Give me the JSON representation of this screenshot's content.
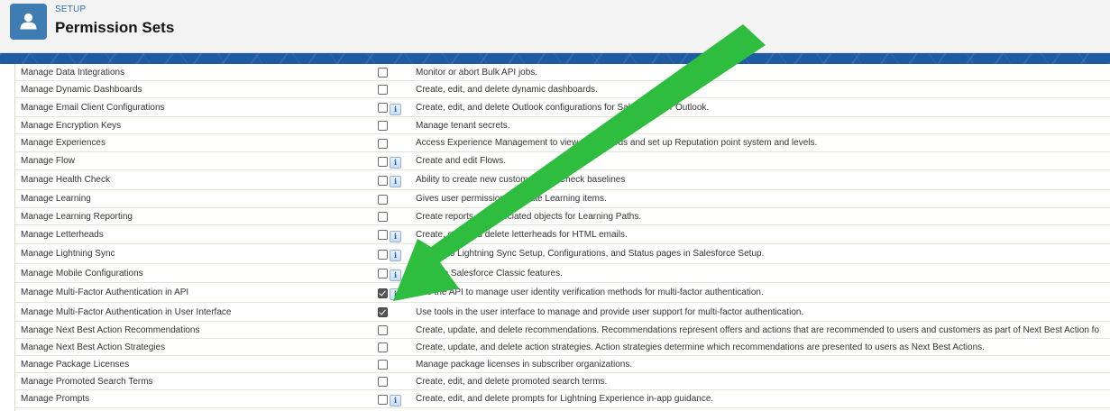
{
  "header": {
    "breadcrumb": "SETUP",
    "title": "Permission Sets",
    "icon": "user-icon",
    "icon_color": "#3e7cb1"
  },
  "annotation": {
    "arrow_color": "#2ebd3e"
  },
  "permissions": [
    {
      "name": "Manage Data Integrations",
      "description": "Monitor or abort Bulk API jobs.",
      "checked": false,
      "info": false
    },
    {
      "name": "Manage Dynamic Dashboards",
      "description": "Create, edit, and delete dynamic dashboards.",
      "checked": false,
      "info": false
    },
    {
      "name": "Manage Email Client Configurations",
      "description": "Create, edit, and delete Outlook configurations for Salesforce for Outlook.",
      "checked": false,
      "info": true
    },
    {
      "name": "Manage Encryption Keys",
      "description": "Manage tenant secrets.",
      "checked": false,
      "info": false
    },
    {
      "name": "Manage Experiences",
      "description": "Access Experience Management to view dashboards and set up Reputation point system and levels.",
      "checked": false,
      "info": false
    },
    {
      "name": "Manage Flow",
      "description": "Create and edit Flows.",
      "checked": false,
      "info": true
    },
    {
      "name": "Manage Health Check",
      "description": "Ability to create new custom Health Check baselines",
      "checked": false,
      "info": true
    },
    {
      "name": "Manage Learning",
      "description": "Gives user permission to create Learning items.",
      "checked": false,
      "info": false
    },
    {
      "name": "Manage Learning Reporting",
      "description": "Create reports on associated objects for Learning Paths.",
      "checked": false,
      "info": false
    },
    {
      "name": "Manage Letterheads",
      "description": "Create, edit, and delete letterheads for HTML emails.",
      "checked": false,
      "info": true
    },
    {
      "name": "Manage Lightning Sync",
      "description": "Access to Lightning Sync Setup, Configurations, and Status pages in Salesforce Setup.",
      "checked": false,
      "info": true
    },
    {
      "name": "Manage Mobile Configurations",
      "description": "Manage Salesforce Classic features.",
      "checked": false,
      "info": true
    },
    {
      "name": "Manage Multi-Factor Authentication in API",
      "description": "Use the API to manage user identity verification methods for multi-factor authentication.",
      "checked": true,
      "info": true
    },
    {
      "name": "Manage Multi-Factor Authentication in User Interface",
      "description": "Use tools in the user interface to manage and provide user support for multi-factor authentication.",
      "checked": true,
      "info": false
    },
    {
      "name": "Manage Next Best Action Recommendations",
      "description": "Create, update, and delete recommendations. Recommendations represent offers and actions that are recommended to users and customers as part of Next Best Action fo",
      "checked": false,
      "info": false
    },
    {
      "name": "Manage Next Best Action Strategies",
      "description": "Create, update, and delete action strategies. Action strategies determine which recommendations are presented to users as Next Best Actions.",
      "checked": false,
      "info": false
    },
    {
      "name": "Manage Package Licenses",
      "description": "Manage package licenses in subscriber organizations.",
      "checked": false,
      "info": false
    },
    {
      "name": "Manage Promoted Search Terms",
      "description": "Create, edit, and delete promoted search terms.",
      "checked": false,
      "info": false
    },
    {
      "name": "Manage Prompts",
      "description": "Create, edit, and delete prompts for Lightning Experience in-app guidance.",
      "checked": false,
      "info": true
    }
  ]
}
